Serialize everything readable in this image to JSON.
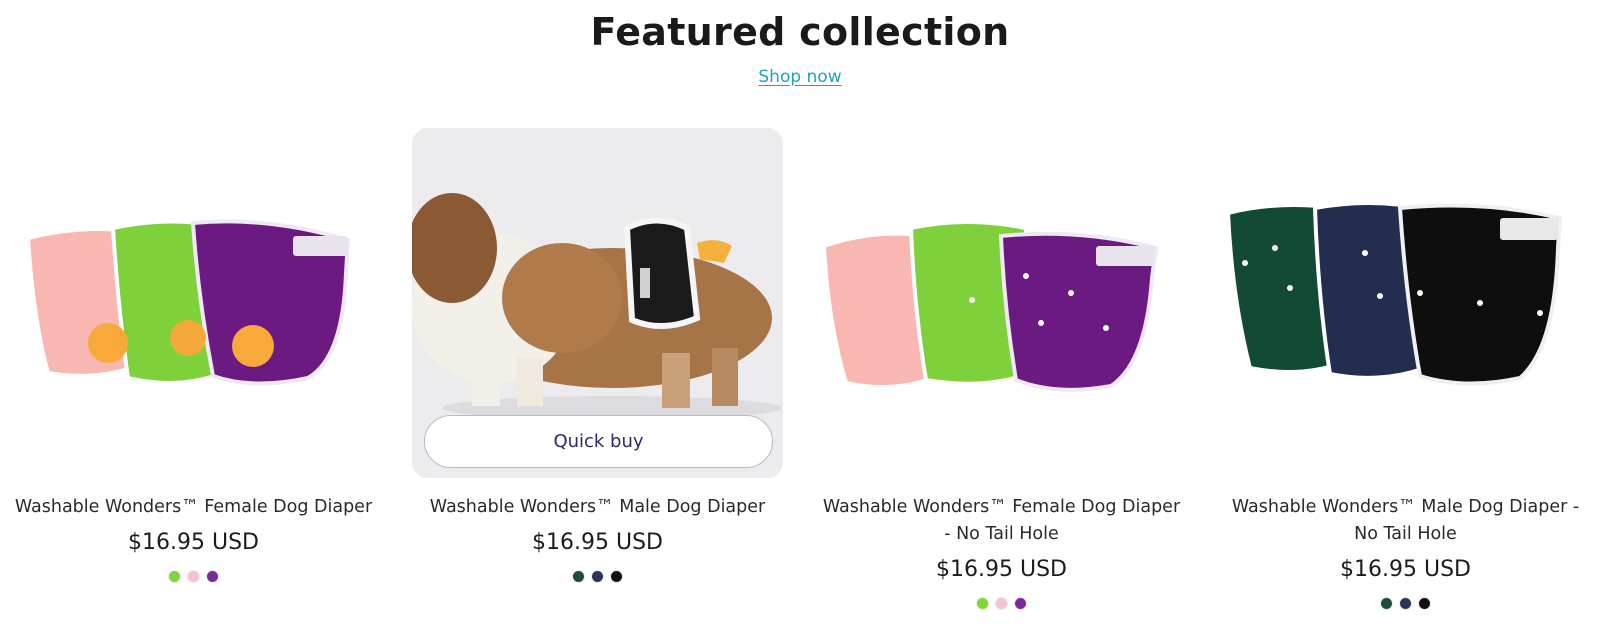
{
  "section": {
    "title": "Featured collection",
    "shop_now": "Shop now"
  },
  "products": [
    {
      "name": "Washable Wonders™ Female Dog Diaper",
      "price": "$16.95 USD",
      "swatches": [
        "#7fd63a",
        "#f5c2d0",
        "#7b2a9c"
      ],
      "image": "pink-green-purple-diapers"
    },
    {
      "name": "Washable Wonders™ Male Dog Diaper",
      "price": "$16.95 USD",
      "swatches": [
        "#1f4d3a",
        "#2b3558",
        "#111111"
      ],
      "image": "dog-wearing-diaper",
      "quick_buy": "Quick buy"
    },
    {
      "name": "Washable Wonders™ Female Dog Diaper - No Tail Hole",
      "price": "$16.95 USD",
      "swatches": [
        "#7fd63a",
        "#f5c2d0",
        "#7b2a9c"
      ],
      "image": "pink-green-purple-diapers-no-tail"
    },
    {
      "name": "Washable Wonders™ Male Dog Diaper - No Tail Hole",
      "price": "$16.95 USD",
      "swatches": [
        "#1f4d3a",
        "#2b3558",
        "#111111"
      ],
      "image": "green-navy-black-diapers"
    }
  ]
}
